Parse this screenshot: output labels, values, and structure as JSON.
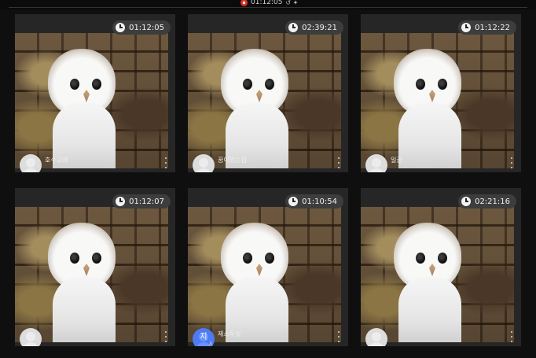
{
  "recording": {
    "time": "01:12:05",
    "extra": "↺ ✦",
    "accent": "#d9332b"
  },
  "cards": [
    {
      "duration": "01:12:05",
      "title": "호수고래",
      "avatar": "default",
      "avatar_letter": ""
    },
    {
      "duration": "02:39:21",
      "title": "꿈이있는집",
      "avatar": "default",
      "avatar_letter": ""
    },
    {
      "duration": "01:12:22",
      "title": "일꿈",
      "avatar": "default",
      "avatar_letter": ""
    },
    {
      "duration": "01:12:07",
      "title": "",
      "avatar": "default",
      "avatar_letter": ""
    },
    {
      "duration": "01:10:54",
      "title": "제스투핏",
      "avatar": "blue",
      "avatar_letter": "지"
    },
    {
      "duration": "02:21:16",
      "title": "",
      "avatar": "default",
      "avatar_letter": ""
    }
  ],
  "icons": {
    "clock": "clock-icon",
    "more": "more-vertical-icon",
    "person": "person-icon"
  }
}
